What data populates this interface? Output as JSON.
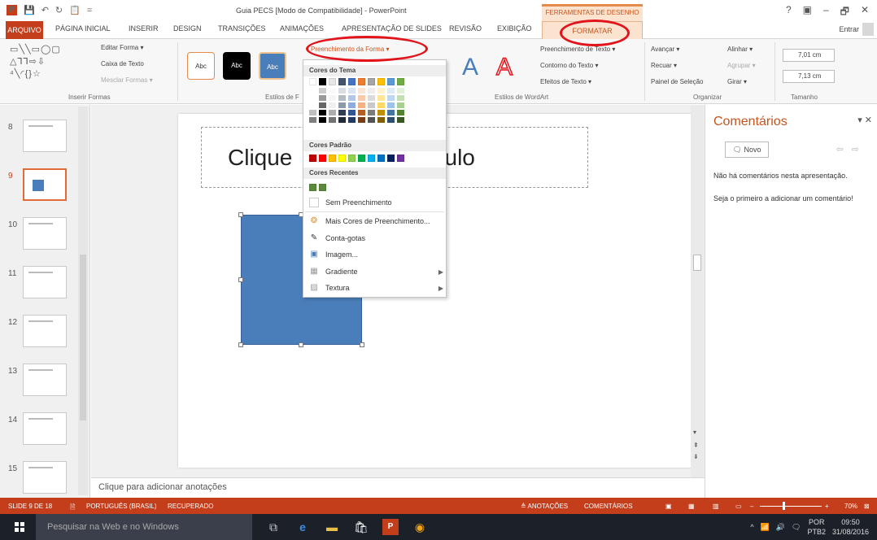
{
  "window": {
    "app_title": "Guia PECS [Modo de Compatibilidade] - PowerPoint",
    "context_group": "FERRAMENTAS DE DESENHO",
    "help": "?",
    "restore_icon": "▣",
    "minimize": "–",
    "maximize": "🗗",
    "close": "✕"
  },
  "qat": {
    "logo": "P",
    "save": "💾",
    "undo": "↶",
    "redo": "↻",
    "start": "📋",
    "more": "="
  },
  "tabs": {
    "file": "ARQUIVO",
    "home": "PÁGINA INICIAL",
    "insert": "INSERIR",
    "design": "DESIGN",
    "transitions": "TRANSIÇÕES",
    "animations": "ANIMAÇÕES",
    "slideshow": "APRESENTAÇÃO DE SLIDES",
    "review": "REVISÃO",
    "view": "EXIBIÇÃO",
    "format": "FORMATAR",
    "sign_in": "Entrar"
  },
  "ribbon": {
    "insert_shapes": {
      "label": "Inserir Formas",
      "gallery_row1": "▭╲╲▭◯▢",
      "gallery_row2": "△⅂⅂⇨⇩",
      "gallery_row3": "⁴╲◜{}☆",
      "edit_shape": "Editar Forma ▾",
      "text_box": "Caixa de Texto",
      "merge_shapes": "Mesclar Formas ▾"
    },
    "shape_styles": {
      "label": "Estilos de F",
      "style_text": "Abc",
      "fill_button": "Preenchimento da Forma ▾"
    },
    "wordart": {
      "label": "Estilos de WordArt",
      "letter": "A",
      "text_fill": "Preenchimento de Texto ▾",
      "text_outline": "Contorno do Texto ▾",
      "text_effects": "Efeitos de Texto ▾"
    },
    "arrange": {
      "label": "Organizar",
      "bring_forward": "Avançar  ▾",
      "send_backward": "Recuar  ▾",
      "selection_pane": "Painel de Seleção",
      "align": "Alinhar ▾",
      "group": "Agrupar ▾",
      "rotate": "Girar ▾"
    },
    "size": {
      "label": "Tamanho",
      "height": "7,01 cm",
      "width": "7,13 cm"
    }
  },
  "fill_menu": {
    "theme_colors": "Cores do Tema",
    "standard_colors": "Cores Padrão",
    "recent_colors": "Cores Recentes",
    "no_fill": "Sem Preenchimento",
    "more_colors": "Mais Cores de Preenchimento...",
    "eyedropper": "Conta-gotas",
    "picture": "Imagem...",
    "gradient": "Gradiente",
    "texture": "Textura",
    "theme_row": [
      "#ffffff",
      "#000000",
      "#e7e6e6",
      "#44546a",
      "#4472c4",
      "#ed7d31",
      "#a5a5a5",
      "#ffc000",
      "#5b9bd5",
      "#70ad47"
    ],
    "standard_row": [
      "#c00000",
      "#ff0000",
      "#ffc000",
      "#ffff00",
      "#92d050",
      "#00b050",
      "#00b0f0",
      "#0070c0",
      "#002060",
      "#7030a0"
    ],
    "recent_row": [
      "#5b8a3a",
      "#5b8a3a"
    ]
  },
  "slides": [
    {
      "num": "8",
      "active": false
    },
    {
      "num": "9",
      "active": true
    },
    {
      "num": "10",
      "active": false
    },
    {
      "num": "11",
      "active": false
    },
    {
      "num": "12",
      "active": false
    },
    {
      "num": "13",
      "active": false
    },
    {
      "num": "14",
      "active": false
    },
    {
      "num": "15",
      "active": false
    }
  ],
  "slide": {
    "title_left": "Clique",
    "title_right": "r um título",
    "shape_color": "#4a7ebb"
  },
  "notes": {
    "placeholder": "Clique para adicionar anotações"
  },
  "comments": {
    "title": "Comentários",
    "new_button": "Novo",
    "msg1": "Não há comentários nesta apresentação.",
    "msg2": "Seja o primeiro a adicionar um comentário!"
  },
  "status": {
    "slide_count": "SLIDE 9 DE 18",
    "language": "PORTUGUÊS (BRASIL)",
    "recovered": "RECUPERADO",
    "notes": "≜ ANOTAÇÕES",
    "comments": "COMENTÁRIOS",
    "zoom": "70%"
  },
  "taskbar": {
    "search": "Pesquisar na Web e no Windows",
    "lang": "POR",
    "layout": "PTB2",
    "time": "09:50",
    "date": "31/08/2016"
  },
  "accent": "#c43e1c"
}
